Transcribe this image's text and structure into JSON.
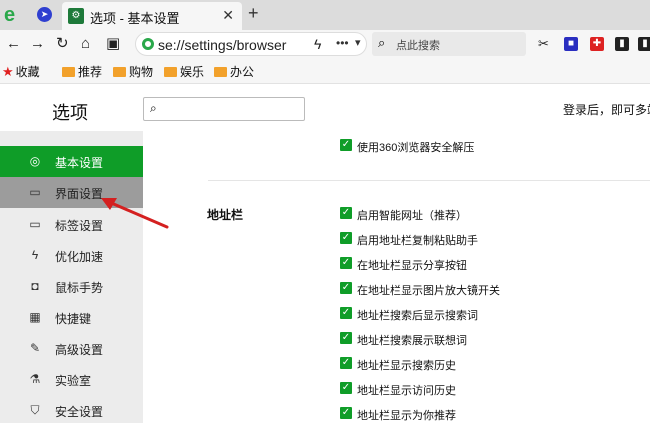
{
  "browser": {
    "tab_title": "选项 - 基本设置",
    "tab_favicon": "settings-icon",
    "url": "se://settings/browser",
    "search_placeholder": "点此搜索"
  },
  "bookmarks": [
    {
      "label": "收藏",
      "icon": "star-icon"
    },
    {
      "label": "推荐",
      "icon": "folder-icon"
    },
    {
      "label": "购物",
      "icon": "folder-icon"
    },
    {
      "label": "娱乐",
      "icon": "folder-icon"
    },
    {
      "label": "办公",
      "icon": "folder-icon"
    }
  ],
  "header": {
    "title": "选项",
    "login_hint": "登录后，即可多端"
  },
  "sidebar": {
    "items": [
      {
        "label": "基本设置",
        "icon": "gear-icon",
        "active": true
      },
      {
        "label": "界面设置",
        "icon": "window-icon",
        "hover": true
      },
      {
        "label": "标签设置",
        "icon": "tab-icon"
      },
      {
        "label": "优化加速",
        "icon": "bolt-icon"
      },
      {
        "label": "鼠标手势",
        "icon": "mouse-icon"
      },
      {
        "label": "快捷键",
        "icon": "keyboard-icon"
      },
      {
        "label": "高级设置",
        "icon": "wrench-icon"
      },
      {
        "label": "实验室",
        "icon": "flask-icon"
      },
      {
        "label": "安全设置",
        "icon": "shield-icon"
      }
    ]
  },
  "content": {
    "top_option": "使用360浏览器安全解压",
    "section_label": "地址栏",
    "options": [
      "启用智能网址（推荐）",
      "启用地址栏复制粘贴助手",
      "在地址栏显示分享按钮",
      "在地址栏显示图片放大镜开关",
      "地址栏搜索后显示搜索词",
      "地址栏搜索展示联想词",
      "地址栏显示搜索历史",
      "地址栏显示访问历史",
      "地址栏显示为你推荐"
    ]
  },
  "colors": {
    "accent": "#0f9d28",
    "arrow": "#d42020"
  }
}
